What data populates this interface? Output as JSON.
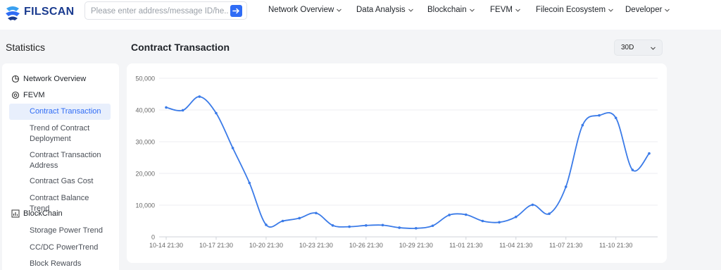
{
  "header": {
    "brand": "FILSCAN",
    "search_placeholder": "Please enter address/message ID/he...",
    "nav": [
      {
        "label": "Network Overview"
      },
      {
        "label": "Data Analysis"
      },
      {
        "label": "Blockchain"
      },
      {
        "label": "FEVM"
      },
      {
        "label": "Filecoin Ecosystem"
      },
      {
        "label": "Developer"
      }
    ]
  },
  "sidebar": {
    "title": "Statistics",
    "groups": [
      {
        "label": "Network Overview",
        "icon": "pie-chart-icon"
      },
      {
        "label": "FEVM",
        "icon": "fevm-icon",
        "items": [
          "Contract Transaction",
          "Trend of Contract Deployment",
          "Contract Transaction Address",
          "Contract Gas Cost",
          "Contract Balance Trend"
        ]
      },
      {
        "label": "BlockChain",
        "icon": "bar-chart-icon",
        "items": [
          "Storage Power Trend",
          "CC/DC PowerTrend",
          "Block Rewards"
        ]
      }
    ],
    "active_item": "Contract Transaction"
  },
  "main": {
    "chart_title": "Contract Transaction",
    "range_select": "30D"
  },
  "colors": {
    "accent": "#2f6cf5",
    "line": "#3b7be8",
    "brand": "#1a3b8f"
  },
  "chart_data": {
    "type": "line",
    "title": "Contract Transaction",
    "ylim": [
      0,
      50000
    ],
    "yticks": [
      "0",
      "10,000",
      "20,000",
      "30,000",
      "40,000",
      "50,000"
    ],
    "xticks": [
      "10-14 21:30",
      "10-17 21:30",
      "10-20 21:30",
      "10-23 21:30",
      "10-26 21:30",
      "10-29 21:30",
      "11-01 21:30",
      "11-04 21:30",
      "11-07 21:30",
      "11-10 21:30"
    ],
    "grid": true,
    "series": [
      {
        "values": [
          40800,
          39900,
          44200,
          39000,
          28000,
          17000,
          3800,
          5000,
          5900,
          7500,
          3600,
          3200,
          3600,
          3700,
          2900,
          2700,
          3500,
          6900,
          7000,
          5000,
          4600,
          6300,
          10100,
          7300,
          15800,
          35200,
          38300,
          37500,
          21100,
          26300
        ]
      }
    ]
  }
}
